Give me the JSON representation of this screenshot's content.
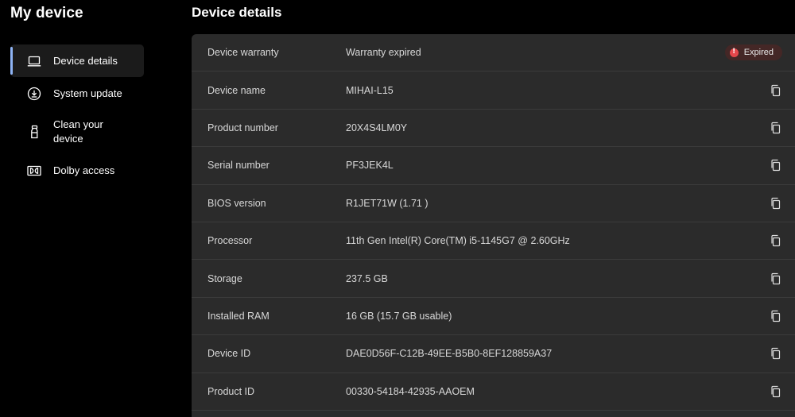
{
  "sidebar": {
    "title": "My device",
    "items": [
      {
        "label": "Device details",
        "icon": "laptop-icon",
        "active": true
      },
      {
        "label": "System update",
        "icon": "download-circle-icon",
        "active": false
      },
      {
        "label": "Clean your device",
        "icon": "spray-bottle-icon",
        "active": false
      },
      {
        "label": "Dolby access",
        "icon": "dolby-icon",
        "active": false
      }
    ]
  },
  "main": {
    "title": "Device details",
    "rows": [
      {
        "label": "Device warranty",
        "value": "Warranty expired",
        "action": "badge"
      },
      {
        "label": "Device name",
        "value": "MIHAI-L15",
        "action": "copy"
      },
      {
        "label": "Product number",
        "value": "20X4S4LM0Y",
        "action": "copy"
      },
      {
        "label": "Serial number",
        "value": "PF3JEK4L",
        "action": "copy"
      },
      {
        "label": "BIOS version",
        "value": "R1JET71W (1.71 )",
        "action": "copy"
      },
      {
        "label": "Processor",
        "value": "11th Gen Intel(R) Core(TM) i5-1145G7 @ 2.60GHz",
        "action": "copy"
      },
      {
        "label": "Storage",
        "value": "237.5 GB",
        "action": "copy"
      },
      {
        "label": "Installed RAM",
        "value": "16 GB (15.7 GB usable)",
        "action": "copy"
      },
      {
        "label": "Device ID",
        "value": "DAE0D56F-C12B-49EE-B5B0-8EF128859A37",
        "action": "copy"
      },
      {
        "label": "Product ID",
        "value": "00330-54184-42935-AAOEM",
        "action": "copy"
      }
    ],
    "warranty_badge": {
      "label": "Expired",
      "color": "#e5474b"
    }
  },
  "colors": {
    "background": "#000000",
    "panel": "#2b2b2b",
    "accent": "#8fb4f5"
  }
}
